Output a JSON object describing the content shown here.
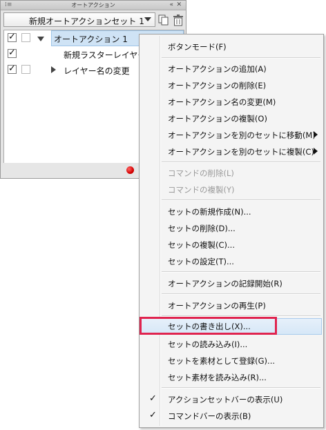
{
  "panel": {
    "title": "オートアクション",
    "grip_icon": "panel-grip-icon",
    "collapse_glyph": "«",
    "close_glyph": "✕",
    "set_selector": {
      "value": "新規オートアクションセット 1"
    },
    "actions": [
      {
        "label": "オートアクション 1",
        "checked": true,
        "expanded": true,
        "selected": true
      },
      {
        "label": "新規ラスターレイヤー",
        "checked": true,
        "child": true
      },
      {
        "label": "レイヤー名の変更",
        "checked": true,
        "child": true,
        "collapsed": true
      }
    ],
    "record_color": "#d40000"
  },
  "menu": {
    "items": [
      {
        "label": "ボタンモード(F)"
      },
      {
        "label": "オートアクションの追加(A)"
      },
      {
        "label": "オートアクションの削除(E)"
      },
      {
        "label": "オートアクション名の変更(M)"
      },
      {
        "label": "オートアクションの複製(O)"
      },
      {
        "label": "オートアクションを別のセットに移動(M)",
        "submenu": true
      },
      {
        "label": "オートアクションを別のセットに複製(C)",
        "submenu": true
      },
      {
        "label": "コマンドの削除(L)",
        "disabled": true
      },
      {
        "label": "コマンドの複製(Y)",
        "disabled": true
      },
      {
        "label": "セットの新規作成(N)..."
      },
      {
        "label": "セットの削除(D)..."
      },
      {
        "label": "セットの複製(C)..."
      },
      {
        "label": "セットの設定(T)..."
      },
      {
        "label": "オートアクションの記録開始(R)"
      },
      {
        "label": "オートアクションの再生(P)"
      },
      {
        "label": "セットの書き出し(X)...",
        "hover": true
      },
      {
        "label": "セットの読み込み(I)..."
      },
      {
        "label": "セットを素材として登録(G)..."
      },
      {
        "label": "セット素材を読み込み(R)..."
      },
      {
        "label": "アクションセットバーの表示(U)",
        "checked": true
      },
      {
        "label": "コマンドバーの表示(B)",
        "checked": true
      }
    ],
    "check_glyph": "✓"
  },
  "colors": {
    "highlight": "#e0234e",
    "hover": "#d6e7f7",
    "selection": "#cfe3f5"
  }
}
